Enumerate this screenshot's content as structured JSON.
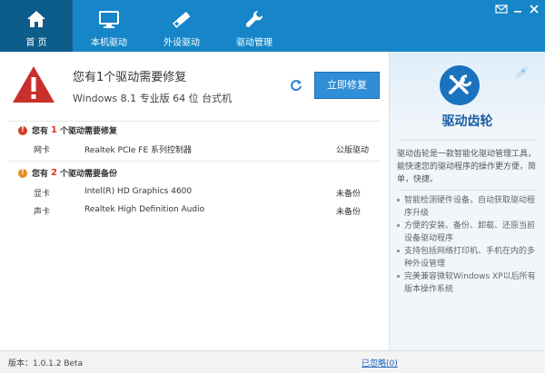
{
  "nav": {
    "items": [
      {
        "label": "首 页",
        "icon": "home-icon"
      },
      {
        "label": "本机驱动",
        "icon": "monitor-icon"
      },
      {
        "label": "外设驱动",
        "icon": "usb-drive-icon"
      },
      {
        "label": "驱动管理",
        "icon": "wrench-icon"
      }
    ],
    "active_index": 0
  },
  "window_controls": [
    "mail-icon",
    "minimize-icon",
    "close-icon"
  ],
  "summary": {
    "title": "您有1个驱动需要修复",
    "subtitle": "Windows 8.1 专业版 64 位 台式机",
    "fix_button": "立即修复"
  },
  "sections": {
    "repair": {
      "prefix": "您有",
      "count": "1",
      "suffix": "个驱动需要修复",
      "rows": [
        {
          "type": "网卡",
          "name": "Realtek PCIe FE 系列控制器",
          "status": "公版驱动"
        }
      ]
    },
    "backup": {
      "prefix": "您有",
      "count": "2",
      "suffix": "个驱动需要备份",
      "rows": [
        {
          "type": "显卡",
          "name": "Intel(R) HD Graphics 4600",
          "status": "未备份"
        },
        {
          "type": "声卡",
          "name": "Realtek High Definition Audio",
          "status": "未备份"
        }
      ]
    }
  },
  "side": {
    "brand": "驱动齿轮",
    "intro": "驱动齿轮是一款智能化驱动管理工具，能快速您的驱动程序的操作更方便，简单，快捷。",
    "features": [
      "智能检测硬件设备，自动获取驱动程序升级",
      "方便的安装、备份、卸载、还原当前设备驱动程序",
      "支持包括网络打印机、手机在内的多种外设管理",
      "完美兼容微软Windows XP以后所有版本操作系统"
    ]
  },
  "footer": {
    "version": "版本：1.0.1.2 Beta",
    "ignored": "已忽略(0)"
  },
  "colors": {
    "topbar": "#1686c8",
    "nav_active": "#0d5d8a",
    "accent_button": "#2f8ed6",
    "warning_red": "#d23c25",
    "warning_orange": "#e78a23",
    "count_red": "#e0341b"
  }
}
